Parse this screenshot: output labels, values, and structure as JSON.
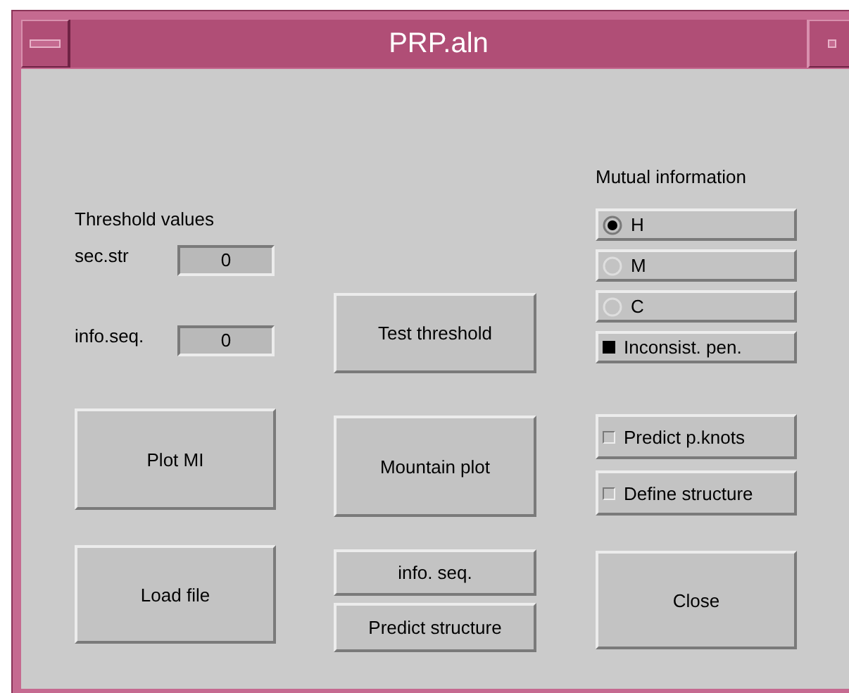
{
  "window": {
    "title": "PRP.aln"
  },
  "threshold": {
    "heading": "Threshold values",
    "fields": [
      {
        "label": "sec.str",
        "value": "0"
      },
      {
        "label": "info.seq.",
        "value": "0"
      }
    ]
  },
  "mutual_information": {
    "heading": "Mutual information",
    "options": [
      {
        "kind": "radio",
        "label": "H",
        "selected": true
      },
      {
        "kind": "radio",
        "label": "M",
        "selected": false
      },
      {
        "kind": "radio",
        "label": "C",
        "selected": false
      },
      {
        "kind": "check",
        "label": "Inconsist. pen.",
        "checked": true
      }
    ]
  },
  "toggles": [
    {
      "label": "Predict p.knots",
      "checked": false
    },
    {
      "label": "Define structure",
      "checked": false
    }
  ],
  "left_buttons": [
    "Plot MI",
    "Load file"
  ],
  "middle_buttons": [
    "Test threshold",
    "Mountain plot",
    "info. seq.",
    "Predict structure"
  ],
  "right_buttons": [
    "Close"
  ]
}
